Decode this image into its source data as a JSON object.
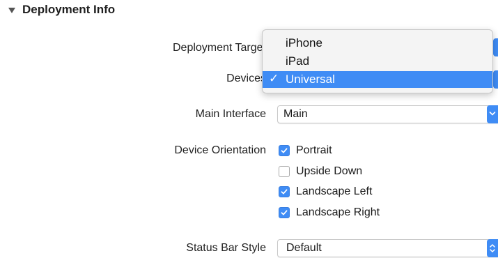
{
  "section": {
    "title": "Deployment Info"
  },
  "labels": {
    "deployment_target": "Deployment Target",
    "devices": "Devices",
    "main_interface": "Main Interface",
    "device_orientation": "Device Orientation",
    "status_bar_style": "Status Bar Style"
  },
  "devices_menu": {
    "items": [
      "iPhone",
      "iPad",
      "Universal"
    ],
    "selected": "Universal",
    "check_glyph": "✓"
  },
  "main_interface": {
    "value": "Main"
  },
  "orientation": {
    "options": [
      {
        "label": "Portrait",
        "checked": true
      },
      {
        "label": "Upside Down",
        "checked": false
      },
      {
        "label": "Landscape Left",
        "checked": true
      },
      {
        "label": "Landscape Right",
        "checked": true
      }
    ]
  },
  "status_bar_style": {
    "value": "Default"
  },
  "colors": {
    "accent": "#3f8cf5"
  },
  "icons": {
    "disclosure": "disclosure-triangle-down-icon",
    "popup_chevron": "chevron-down-icon",
    "popup_updown": "chevron-up-down-icon",
    "checkbox_check": "checkmark-icon"
  }
}
